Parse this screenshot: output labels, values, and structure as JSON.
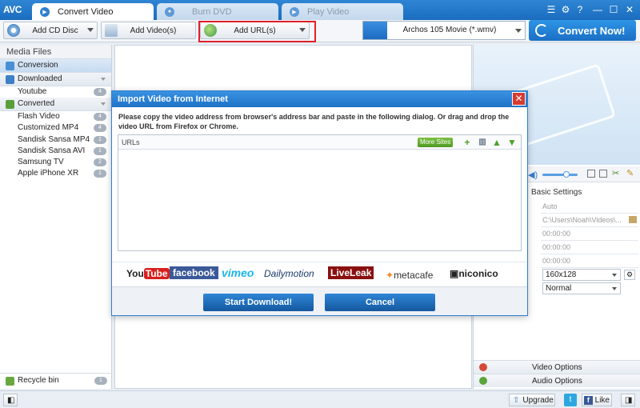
{
  "app": {
    "logo": "AVC",
    "tabs": [
      {
        "label": "Convert Video",
        "active": true
      },
      {
        "label": "Burn DVD",
        "active": false
      },
      {
        "label": "Play Video",
        "active": false
      }
    ]
  },
  "toolbar": {
    "add_cd": "Add CD Disc",
    "add_video": "Add Video(s)",
    "add_url": "Add URL(s)",
    "profile": "Archos 105 Movie (*.wmv)",
    "convert": "Convert Now!"
  },
  "sidebar": {
    "header": "Media Files",
    "conversion": "Conversion",
    "downloaded": {
      "label": "Downloaded",
      "items": [
        {
          "label": "Youtube",
          "count": "4"
        }
      ]
    },
    "converted": {
      "label": "Converted",
      "items": [
        {
          "label": "Flash Video",
          "count": "4"
        },
        {
          "label": "Customized MP4",
          "count": "4"
        },
        {
          "label": "Sandisk Sansa MP4",
          "count": "1"
        },
        {
          "label": "Sandisk Sansa AVI",
          "count": "1"
        },
        {
          "label": "Samsung TV",
          "count": "2"
        },
        {
          "label": "Apple iPhone XR",
          "count": "1"
        }
      ]
    },
    "recycle": {
      "label": "Recycle bin",
      "count": "1"
    }
  },
  "right": {
    "basic_settings": "Basic Settings",
    "rows": [
      "Auto",
      "C:\\Users\\Noah\\Videos\\...",
      "00:00:00",
      "00:00:00",
      "00:00:00"
    ],
    "row_label_partial": "s:",
    "size": "160x128",
    "quality": "Normal",
    "video_options": "Video Options",
    "audio_options": "Audio Options"
  },
  "dialog": {
    "title": "Import Video from Internet",
    "description": "Please copy the video address from browser's address bar and paste in the following dialog. Or drag and drop the video URL from Firefox or Chrome.",
    "urls_label": "URLs",
    "more_sites": "More Sites",
    "logos": [
      "YouTube",
      "facebook",
      "vimeo",
      "Dailymotion",
      "LiveLeak",
      "metacafe",
      "niconico"
    ],
    "start": "Start Download!",
    "cancel": "Cancel"
  },
  "status": {
    "upgrade": "Upgrade",
    "like": "Like"
  }
}
